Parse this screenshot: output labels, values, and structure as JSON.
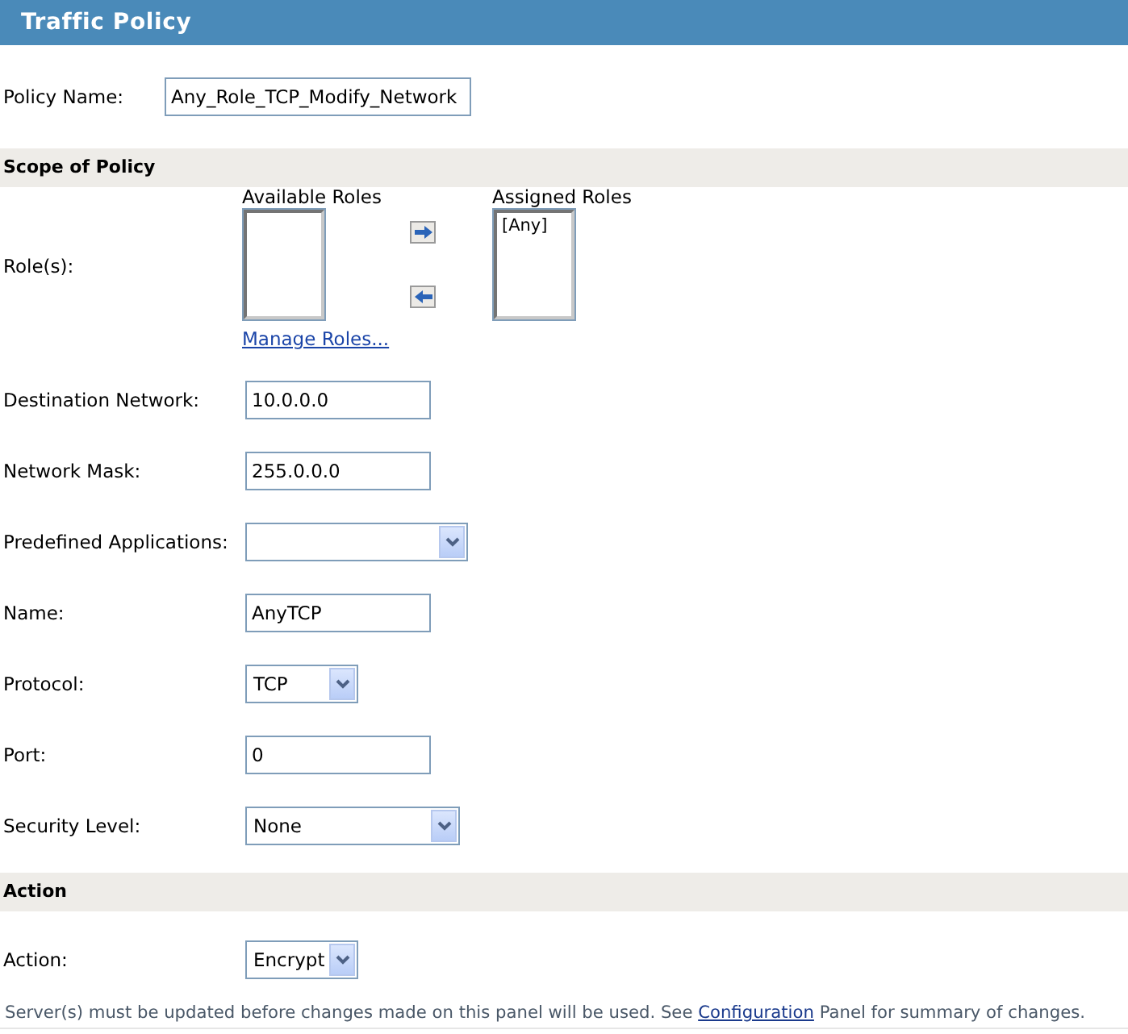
{
  "title": "Traffic Policy",
  "policy_name": {
    "label": "Policy Name:",
    "value": "Any_Role_TCP_Modify_Network"
  },
  "sections": [
    {
      "heading": "Scope of Policy",
      "fields": [
        {
          "kind": "roles",
          "label": "Role(s):",
          "available_heading": "Available Roles",
          "assigned_heading": "Assigned Roles",
          "assigned_items": [
            "[Any]"
          ],
          "link": "Manage Roles..."
        },
        {
          "kind": "text",
          "label": "Destination Network:",
          "value": "10.0.0.0"
        },
        {
          "kind": "text",
          "label": "Network Mask:",
          "value": "255.0.0.0"
        },
        {
          "kind": "select",
          "label": "Predefined Applications:"
        },
        {
          "kind": "text",
          "label": "Name:",
          "value": "AnyTCP"
        },
        {
          "kind": "select",
          "label": "Protocol:",
          "value": "TCP"
        },
        {
          "kind": "text",
          "label": "Port:",
          "value": "0"
        },
        {
          "kind": "select",
          "label": "Security Level:",
          "value": "None"
        }
      ]
    },
    {
      "heading": "Action",
      "fields": [
        {
          "kind": "select",
          "label": "Action:",
          "value": "Encrypt"
        }
      ]
    }
  ],
  "note": {
    "before": "Server(s) must be updated before changes made on this panel will be used. See ",
    "link": "Configuration",
    "after": " Panel for summary of changes."
  }
}
